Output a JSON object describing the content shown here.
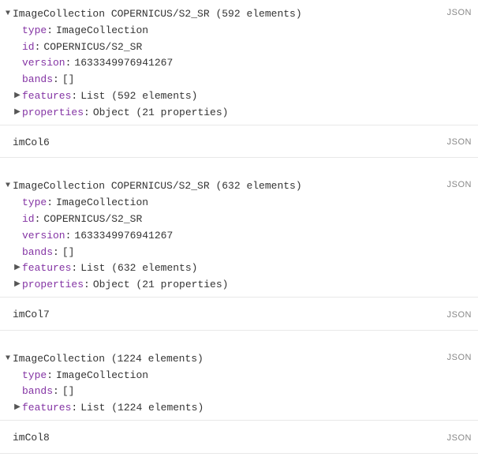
{
  "blocks": [
    {
      "title": "ImageCollection COPERNICUS/S2_SR (592 elements)",
      "jsonLabel": "JSON",
      "expanded": true,
      "props": [
        {
          "key": "type",
          "val": "ImageCollection",
          "expandable": false
        },
        {
          "key": "id",
          "val": "COPERNICUS/S2_SR",
          "expandable": false
        },
        {
          "key": "version",
          "val": "1633349976941267",
          "expandable": false
        },
        {
          "key": "bands",
          "val": "[]",
          "expandable": false
        },
        {
          "key": "features",
          "val": "List (592 elements)",
          "expandable": true
        },
        {
          "key": "properties",
          "val": "Object (21 properties)",
          "expandable": true
        }
      ],
      "varname": "imCol6",
      "varJsonLabel": "JSON"
    },
    {
      "title": "ImageCollection COPERNICUS/S2_SR (632 elements)",
      "jsonLabel": "JSON",
      "expanded": true,
      "props": [
        {
          "key": "type",
          "val": "ImageCollection",
          "expandable": false
        },
        {
          "key": "id",
          "val": "COPERNICUS/S2_SR",
          "expandable": false
        },
        {
          "key": "version",
          "val": "1633349976941267",
          "expandable": false
        },
        {
          "key": "bands",
          "val": "[]",
          "expandable": false
        },
        {
          "key": "features",
          "val": "List (632 elements)",
          "expandable": true
        },
        {
          "key": "properties",
          "val": "Object (21 properties)",
          "expandable": true
        }
      ],
      "varname": "imCol7",
      "varJsonLabel": "JSON"
    },
    {
      "title": "ImageCollection (1224 elements)",
      "jsonLabel": "JSON",
      "expanded": true,
      "props": [
        {
          "key": "type",
          "val": "ImageCollection",
          "expandable": false
        },
        {
          "key": "bands",
          "val": "[]",
          "expandable": false
        },
        {
          "key": "features",
          "val": "List (1224 elements)",
          "expandable": true
        }
      ],
      "varname": "imCol8",
      "varJsonLabel": "JSON"
    }
  ],
  "glyphs": {
    "down": "▼",
    "right": "▶"
  }
}
